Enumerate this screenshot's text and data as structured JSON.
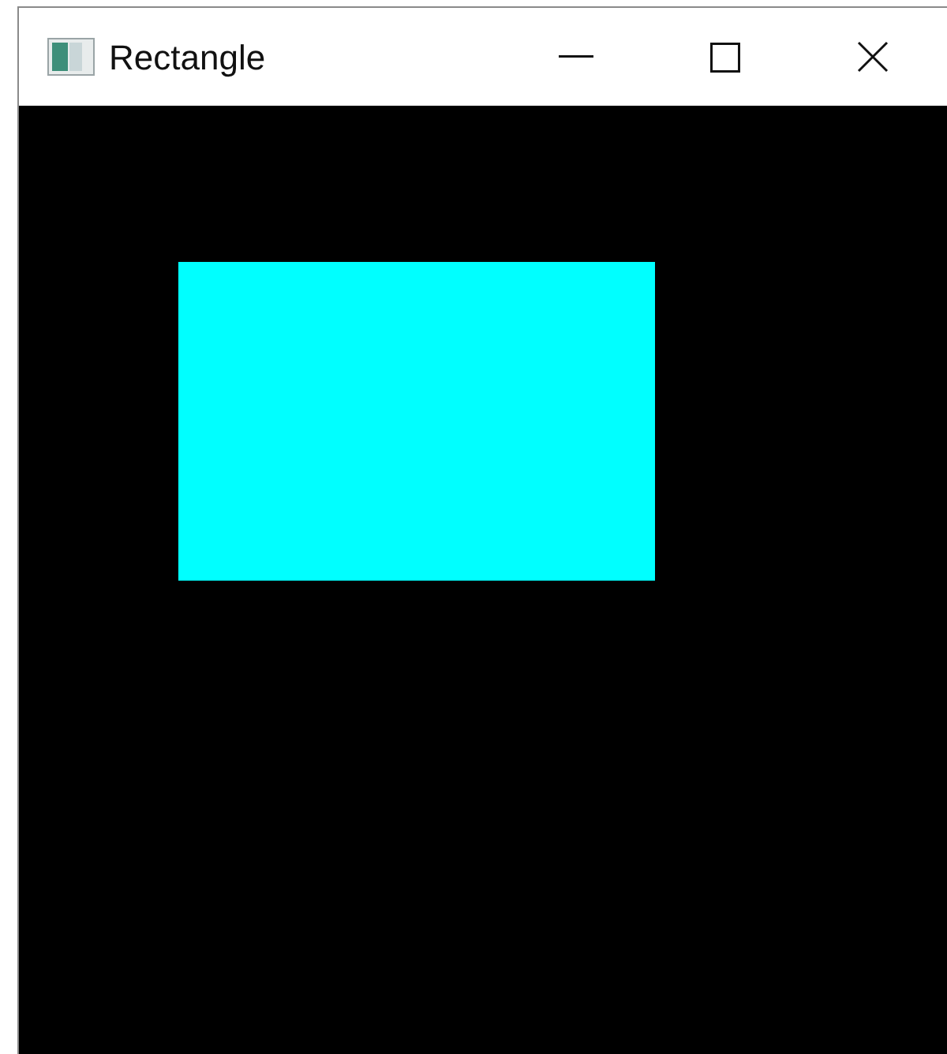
{
  "window": {
    "title": "Rectangle"
  }
}
